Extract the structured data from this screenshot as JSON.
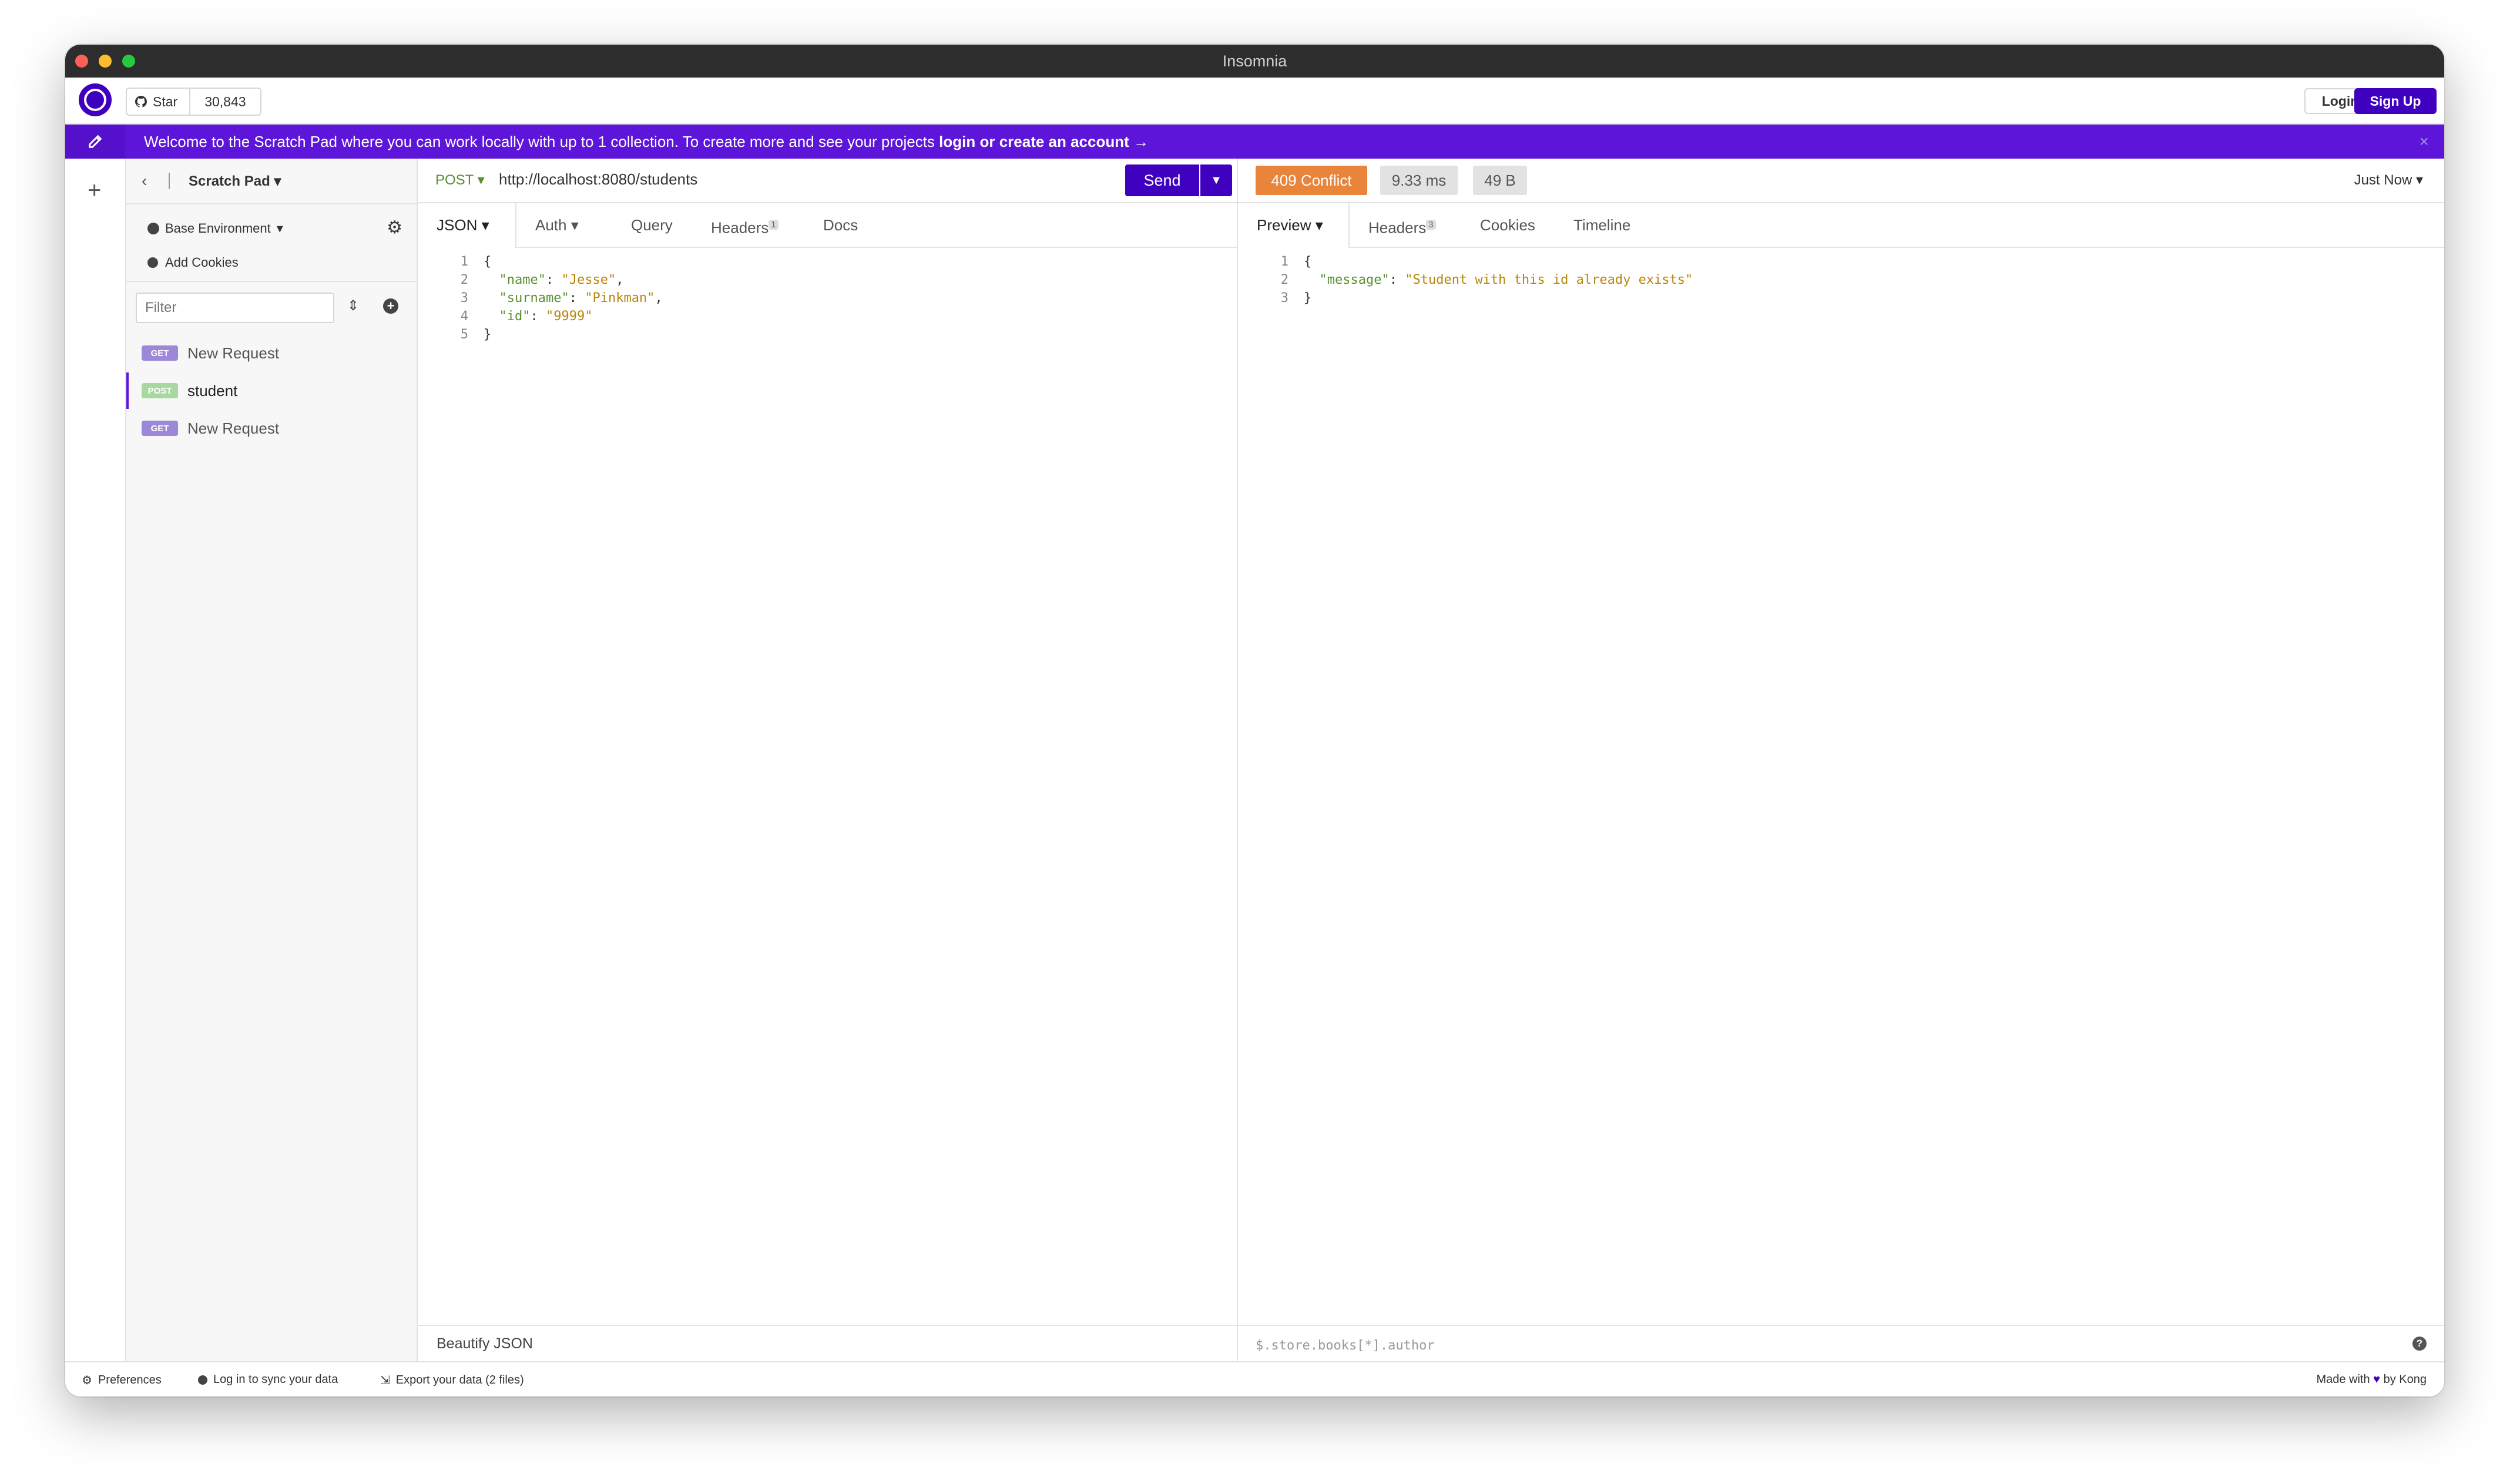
{
  "window": {
    "title": "Insomnia"
  },
  "topbar": {
    "star_label": "Star",
    "star_count": "30,843",
    "login": "Login",
    "signup": "Sign Up"
  },
  "banner": {
    "text": "Welcome to the Scratch Pad where you can work locally with up to 1 collection. To create more and see your projects ",
    "link": "login or create an account →",
    "close": "×"
  },
  "sidebar": {
    "title": "Scratch Pad",
    "environment": "Base Environment",
    "add_cookies": "Add Cookies",
    "filter_placeholder": "Filter",
    "requests": [
      {
        "method": "GET",
        "name": "New Request"
      },
      {
        "method": "POST",
        "name": "student"
      },
      {
        "method": "GET",
        "name": "New Request"
      }
    ]
  },
  "request": {
    "method": "POST",
    "url": "http://localhost:8080/students",
    "send": "Send",
    "tabs": {
      "body": "JSON",
      "auth": "Auth",
      "query": "Query",
      "headers": "Headers",
      "headers_count": "1",
      "docs": "Docs"
    },
    "body_lines": [
      "1",
      "2",
      "3",
      "4",
      "5"
    ],
    "body": {
      "open": "{",
      "name_key": "\"name\"",
      "name_val": "\"Jesse\"",
      "surname_key": "\"surname\"",
      "surname_val": "\"Pinkman\"",
      "id_key": "\"id\"",
      "id_val": "\"9999\"",
      "close": "}"
    },
    "footer": "Beautify JSON"
  },
  "response": {
    "status": "409 Conflict",
    "time": "9.33 ms",
    "size": "49 B",
    "when": "Just Now",
    "tabs": {
      "preview": "Preview",
      "headers": "Headers",
      "headers_count": "3",
      "cookies": "Cookies",
      "timeline": "Timeline"
    },
    "lines": [
      "1",
      "2",
      "3"
    ],
    "body": {
      "open": "{",
      "key": "\"message\"",
      "val": "\"Student with this id already exists\"",
      "close": "}"
    },
    "filter_placeholder": "$.store.books[*].author",
    "help": "?"
  },
  "statusbar": {
    "preferences": "Preferences",
    "sync": "Log in to sync your data",
    "export": "Export your data (2 files)",
    "made_prefix": "Made with",
    "made_suffix": "by Kong"
  },
  "colors": {
    "accent": "#4000bf",
    "banner": "#5d15d9",
    "status_conflict": "#e9843b"
  }
}
